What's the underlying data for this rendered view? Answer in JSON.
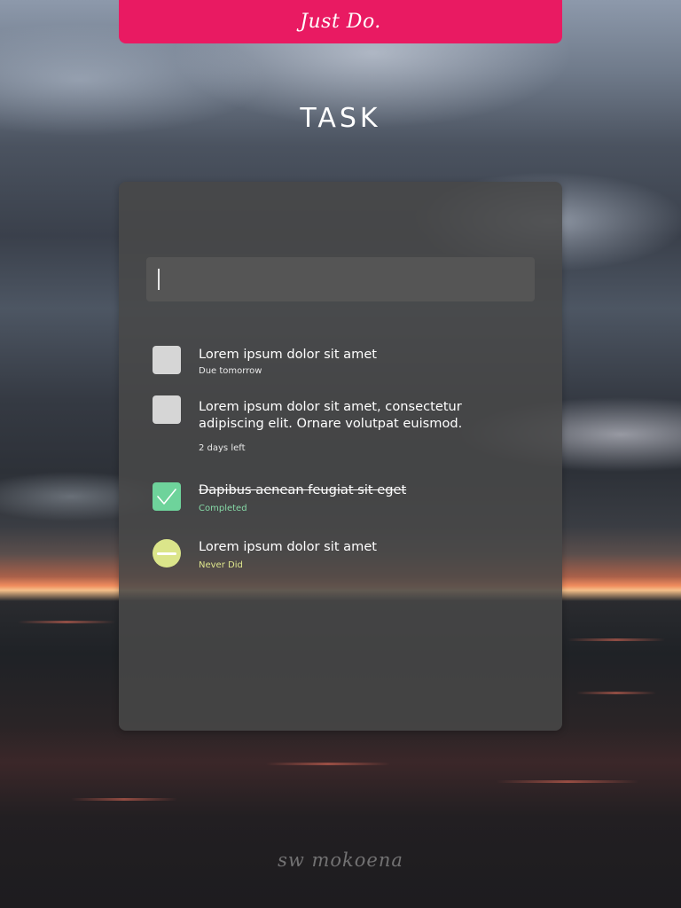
{
  "header": {
    "app_title": "Just Do.",
    "bar_color": "#e91a62"
  },
  "page": {
    "title": "TASK"
  },
  "task_input": {
    "value": "",
    "placeholder": ""
  },
  "tasks": [
    {
      "text": "Lorem ipsum dolor sit amet",
      "meta": "Due tomorrow",
      "status": "pending",
      "icon": "empty-checkbox-icon"
    },
    {
      "text": "Lorem ipsum dolor sit amet, consectetur adipiscing elit. Ornare volutpat euismod.",
      "meta": "2 days left",
      "status": "pending",
      "icon": "empty-checkbox-icon"
    },
    {
      "text": "Dapibus aenean feugiat sit eget",
      "meta": "Completed",
      "status": "completed",
      "icon": "checkmark-icon",
      "color": "#6ed39b"
    },
    {
      "text": "Lorem ipsum dolor sit amet",
      "meta": "Never Did",
      "status": "never",
      "icon": "minus-circle-icon",
      "color": "#dbe58a"
    }
  ],
  "footer": {
    "signature": "sw mokoena"
  }
}
